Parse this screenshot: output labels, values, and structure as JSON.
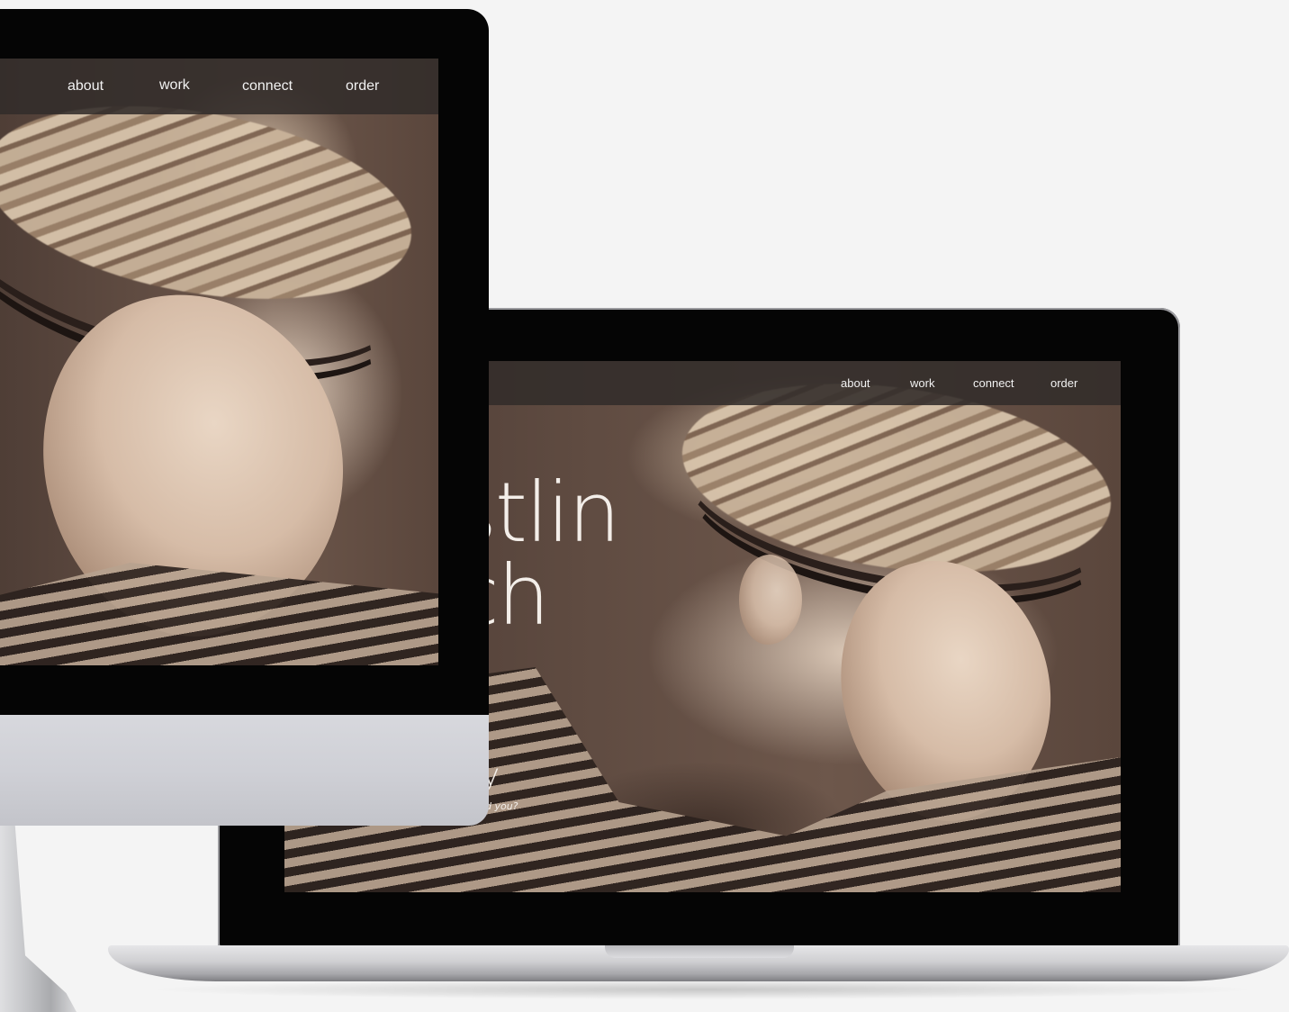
{
  "imac": {
    "nav": {
      "about": "about",
      "work": "work",
      "connect": "connect",
      "order": "order"
    }
  },
  "macbook": {
    "nav": {
      "about": "about",
      "work": "work",
      "connect": "connect",
      "order": "order"
    },
    "hero": {
      "line1_fragment": "stlin",
      "line2_fragment": "ch",
      "subheading_fragment": "ry",
      "tagline_fragment": "nd you?"
    }
  },
  "colors": {
    "background": "#f4f4f4",
    "navbar": "#322c2a",
    "bezel": "#050505",
    "imac_chin": "#d7d8dd"
  }
}
